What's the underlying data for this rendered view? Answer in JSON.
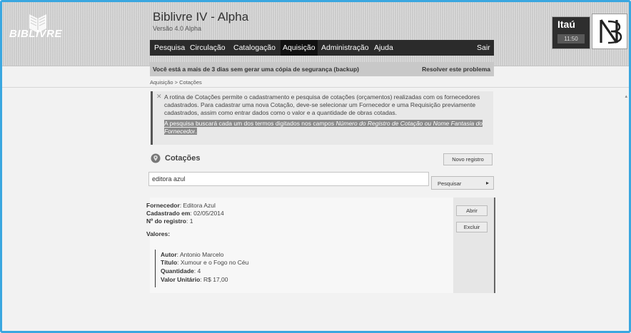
{
  "branding": {
    "logo_text": "BIBLIVRE",
    "app_title": "Biblivre IV - Alpha",
    "version": "Versão 4.0 Alpha"
  },
  "institution": {
    "name": "Itaú",
    "time": "11:50"
  },
  "nav": {
    "items": [
      "Pesquisa",
      "Circulação",
      "Catalogação",
      "Aquisição",
      "Administração",
      "Ajuda"
    ],
    "active": "Aquisição",
    "logout": "Sair"
  },
  "warning": {
    "text": "Você está a mais de 3 dias sem gerar uma cópia de segurança (backup)",
    "action": "Resolver este problema"
  },
  "breadcrumb": "Aquisição > Cotações",
  "help": {
    "close_symbol": "✕",
    "text": "A rotina de Cotações permite o cadastramento e pesquisa de cotações (orçamentos) realizadas com os fornecedores cadastrados. Para cadastrar uma nova Cotação, deve-se selecionar um Fornecedor e uma Requisição previamente cadastrados, assim como entrar dados como o valor e a quantidade de obras cotadas.",
    "highlight_prefix": "A pesquisa buscará cada um dos termos digitados nos campos ",
    "highlight_fields": "Número do Registro de Cotação ou Nome Fantasia do Fornecedor",
    "highlight_suffix": "."
  },
  "section": {
    "title": "Cotações",
    "new_button": "Novo registro"
  },
  "search": {
    "value": "editora azul",
    "button": "Pesquisar",
    "button_arrow": "▸"
  },
  "result": {
    "supplier_label": "Fornecedor",
    "supplier_value": "Editora Azul",
    "registered_label": "Cadastrado em",
    "registered_value": "02/05/2014",
    "record_label": "Nº do registro",
    "record_value": "1",
    "values_label": "Valores:",
    "item": {
      "author_label": "Autor",
      "author_value": "Antonio Marcelo",
      "title_label": "Título",
      "title_value": "Xumour e o Fogo no Céu",
      "quantity_label": "Quantidade",
      "quantity_value": "4",
      "unit_value_label": "Valor Unitário",
      "unit_value_value": "R$ 17,00"
    },
    "open_button": "Abrir",
    "delete_button": "Excluir"
  },
  "colors": {
    "frame_border": "#3aa7e0",
    "nav_background": "#2b2b2b",
    "header_background": "#d2d2d2"
  },
  "icons": [
    "open-book-icon",
    "institution-logo-icon",
    "location-pin-icon",
    "close-icon",
    "arrow-right-icon"
  ]
}
